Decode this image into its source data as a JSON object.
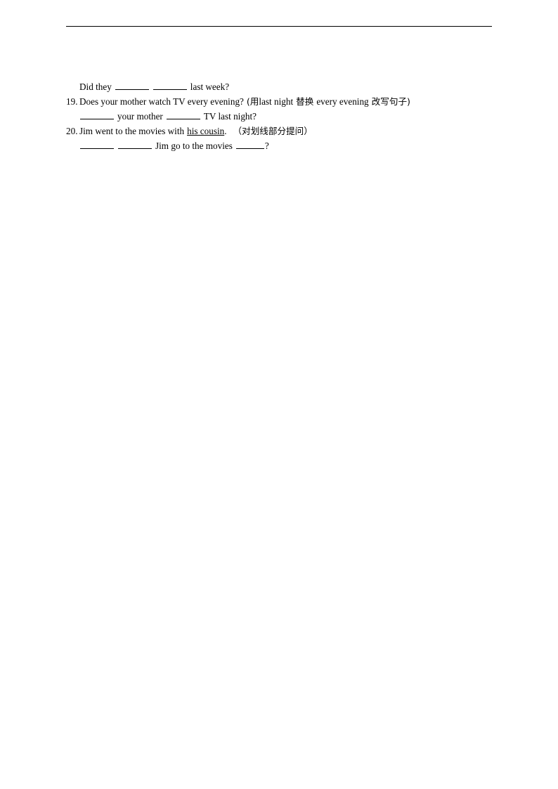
{
  "page": {
    "background_color": "#ffffff",
    "text_color": "#000000",
    "header_rule_color": "#000000"
  },
  "exercise": {
    "carryover_line": {
      "text_before": "Did they",
      "text_after": "last week?"
    },
    "items": [
      {
        "number": "19.",
        "prompt_en": "Does your mother watch TV every evening?",
        "prompt_instruction_open": "(用",
        "prompt_instruction_term1": "last night",
        "prompt_instruction_mid": "替换",
        "prompt_instruction_term2": "every evening",
        "prompt_instruction_tail": "改写句子)",
        "answer_mid": "your mother",
        "answer_tail": "TV last night?"
      },
      {
        "number": "20.",
        "prompt_before": "Jim went to the movies with",
        "prompt_underlined": "his cousin",
        "prompt_period": ".",
        "prompt_instruction": "（对划线部分提问）",
        "answer_mid": "Jim go to the movies",
        "answer_tail": "?"
      }
    ]
  }
}
